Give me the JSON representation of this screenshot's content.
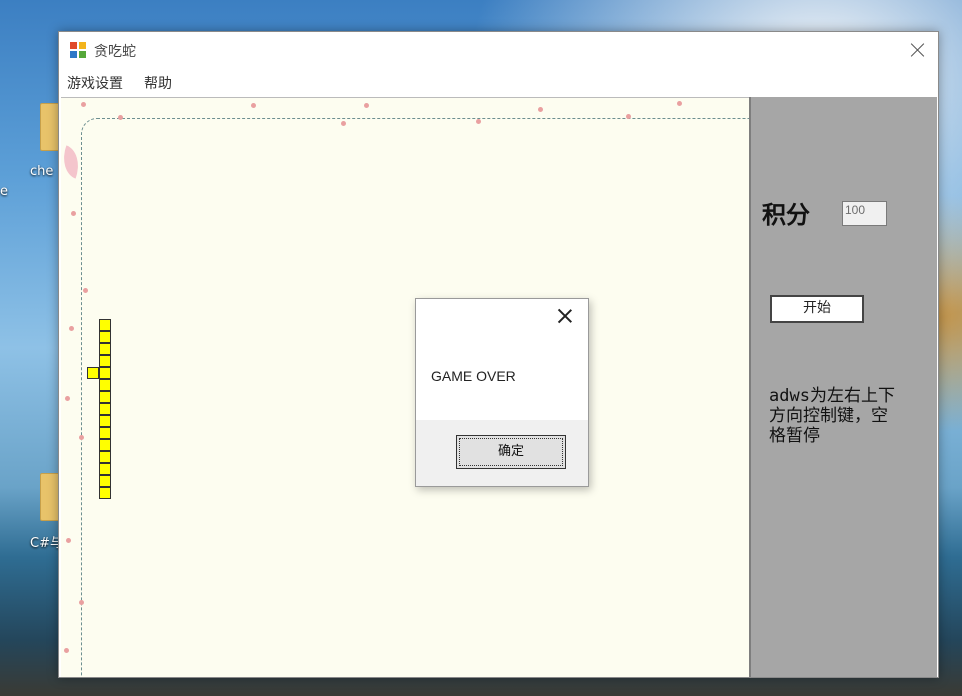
{
  "desktop": {
    "icons": [
      {
        "label": "che"
      },
      {
        "label": "C#与"
      }
    ],
    "edge_label": "e"
  },
  "window": {
    "title": "贪吃蛇",
    "icon": "app-icon"
  },
  "menu": {
    "items": [
      "游戏设置",
      "帮助"
    ]
  },
  "side_panel": {
    "score_label": "积分",
    "score_value": "100",
    "start_label": "开始",
    "help_text": "adws为左右上下方向控制键，空格暂停"
  },
  "dialog": {
    "message": "GAME OVER",
    "ok_label": "确定"
  },
  "colors": {
    "snake": "#ffff00",
    "board": "#fdfdf0",
    "panel": "#a6a6a6"
  }
}
